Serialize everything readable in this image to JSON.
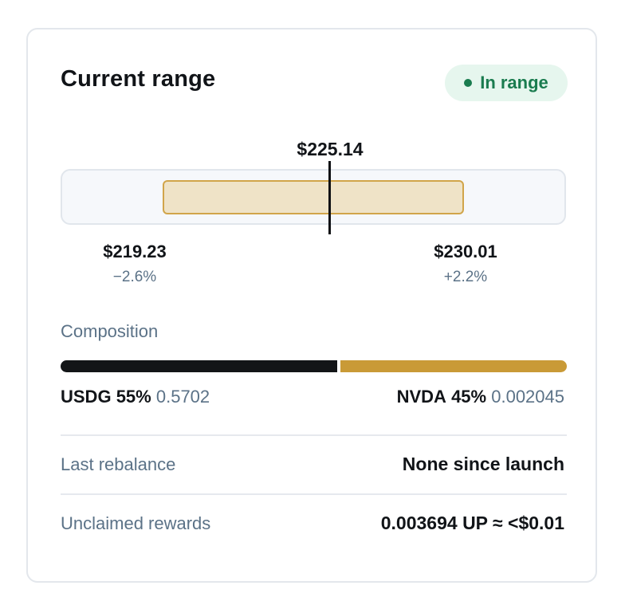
{
  "card": {
    "title": "Current range",
    "status": {
      "label": "In range",
      "color": "#1a7c4f",
      "icon": "status-dot-icon"
    }
  },
  "range": {
    "current_price": "$225.14",
    "lower": {
      "price": "$219.23",
      "change": "−2.6%"
    },
    "upper": {
      "price": "$230.01",
      "change": "+2.2%"
    }
  },
  "composition": {
    "label": "Composition",
    "assets": [
      {
        "name": "USDG",
        "percent": "55%",
        "amount": "0.5702",
        "share": 0.55,
        "color": "#131517"
      },
      {
        "name": "NVDA",
        "percent": "45%",
        "amount": "0.002045",
        "share": 0.45,
        "color": "#c99a37"
      }
    ]
  },
  "details": {
    "last_rebalance": {
      "label": "Last rebalance",
      "value": "None since launch"
    },
    "unclaimed_rewards": {
      "label": "Unclaimed rewards",
      "value": "0.003694 UP ≈ <$0.01"
    }
  }
}
